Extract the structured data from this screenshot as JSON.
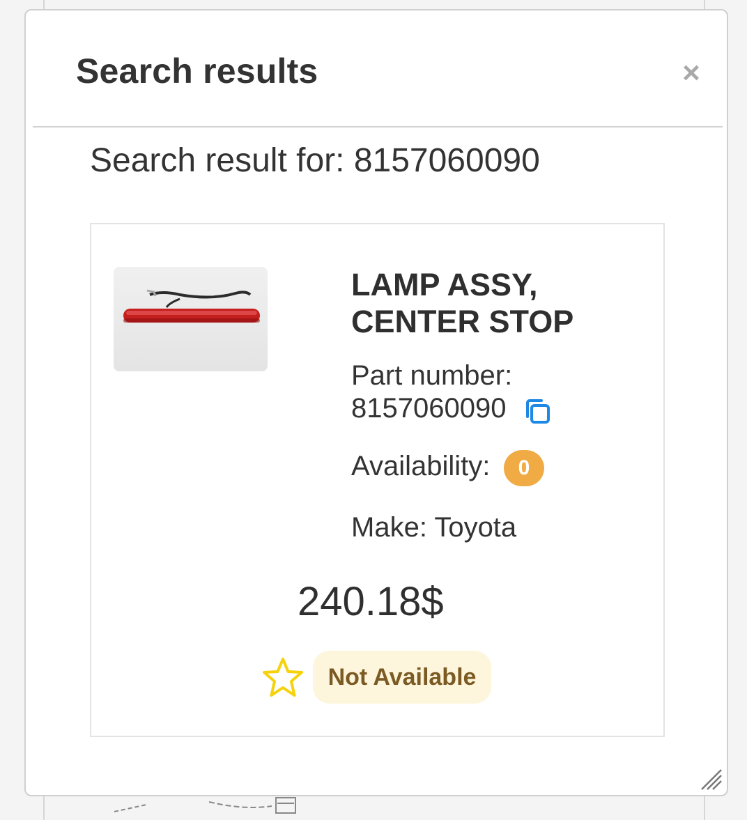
{
  "modal": {
    "title": "Search results",
    "close_label": "×"
  },
  "search": {
    "result_label": "Search result for: 8157060090"
  },
  "product": {
    "name": "LAMP ASSY, CENTER STOP",
    "image_icon": "product-thumbnail",
    "part_number_label": "Part number:",
    "part_number": "8157060090",
    "copy_icon": "copy-icon",
    "availability_label": "Availability:",
    "availability_count": "0",
    "make": "Make: Toyota",
    "price": "240.18$",
    "favorite_icon": "star-icon",
    "status": "Not Available"
  },
  "colors": {
    "badge_orange": "#f0ab45",
    "status_bg": "#fdf6dd",
    "status_text": "#7b5a23",
    "copy_blue": "#1e88e5",
    "star_yellow": "#f5d20b"
  }
}
